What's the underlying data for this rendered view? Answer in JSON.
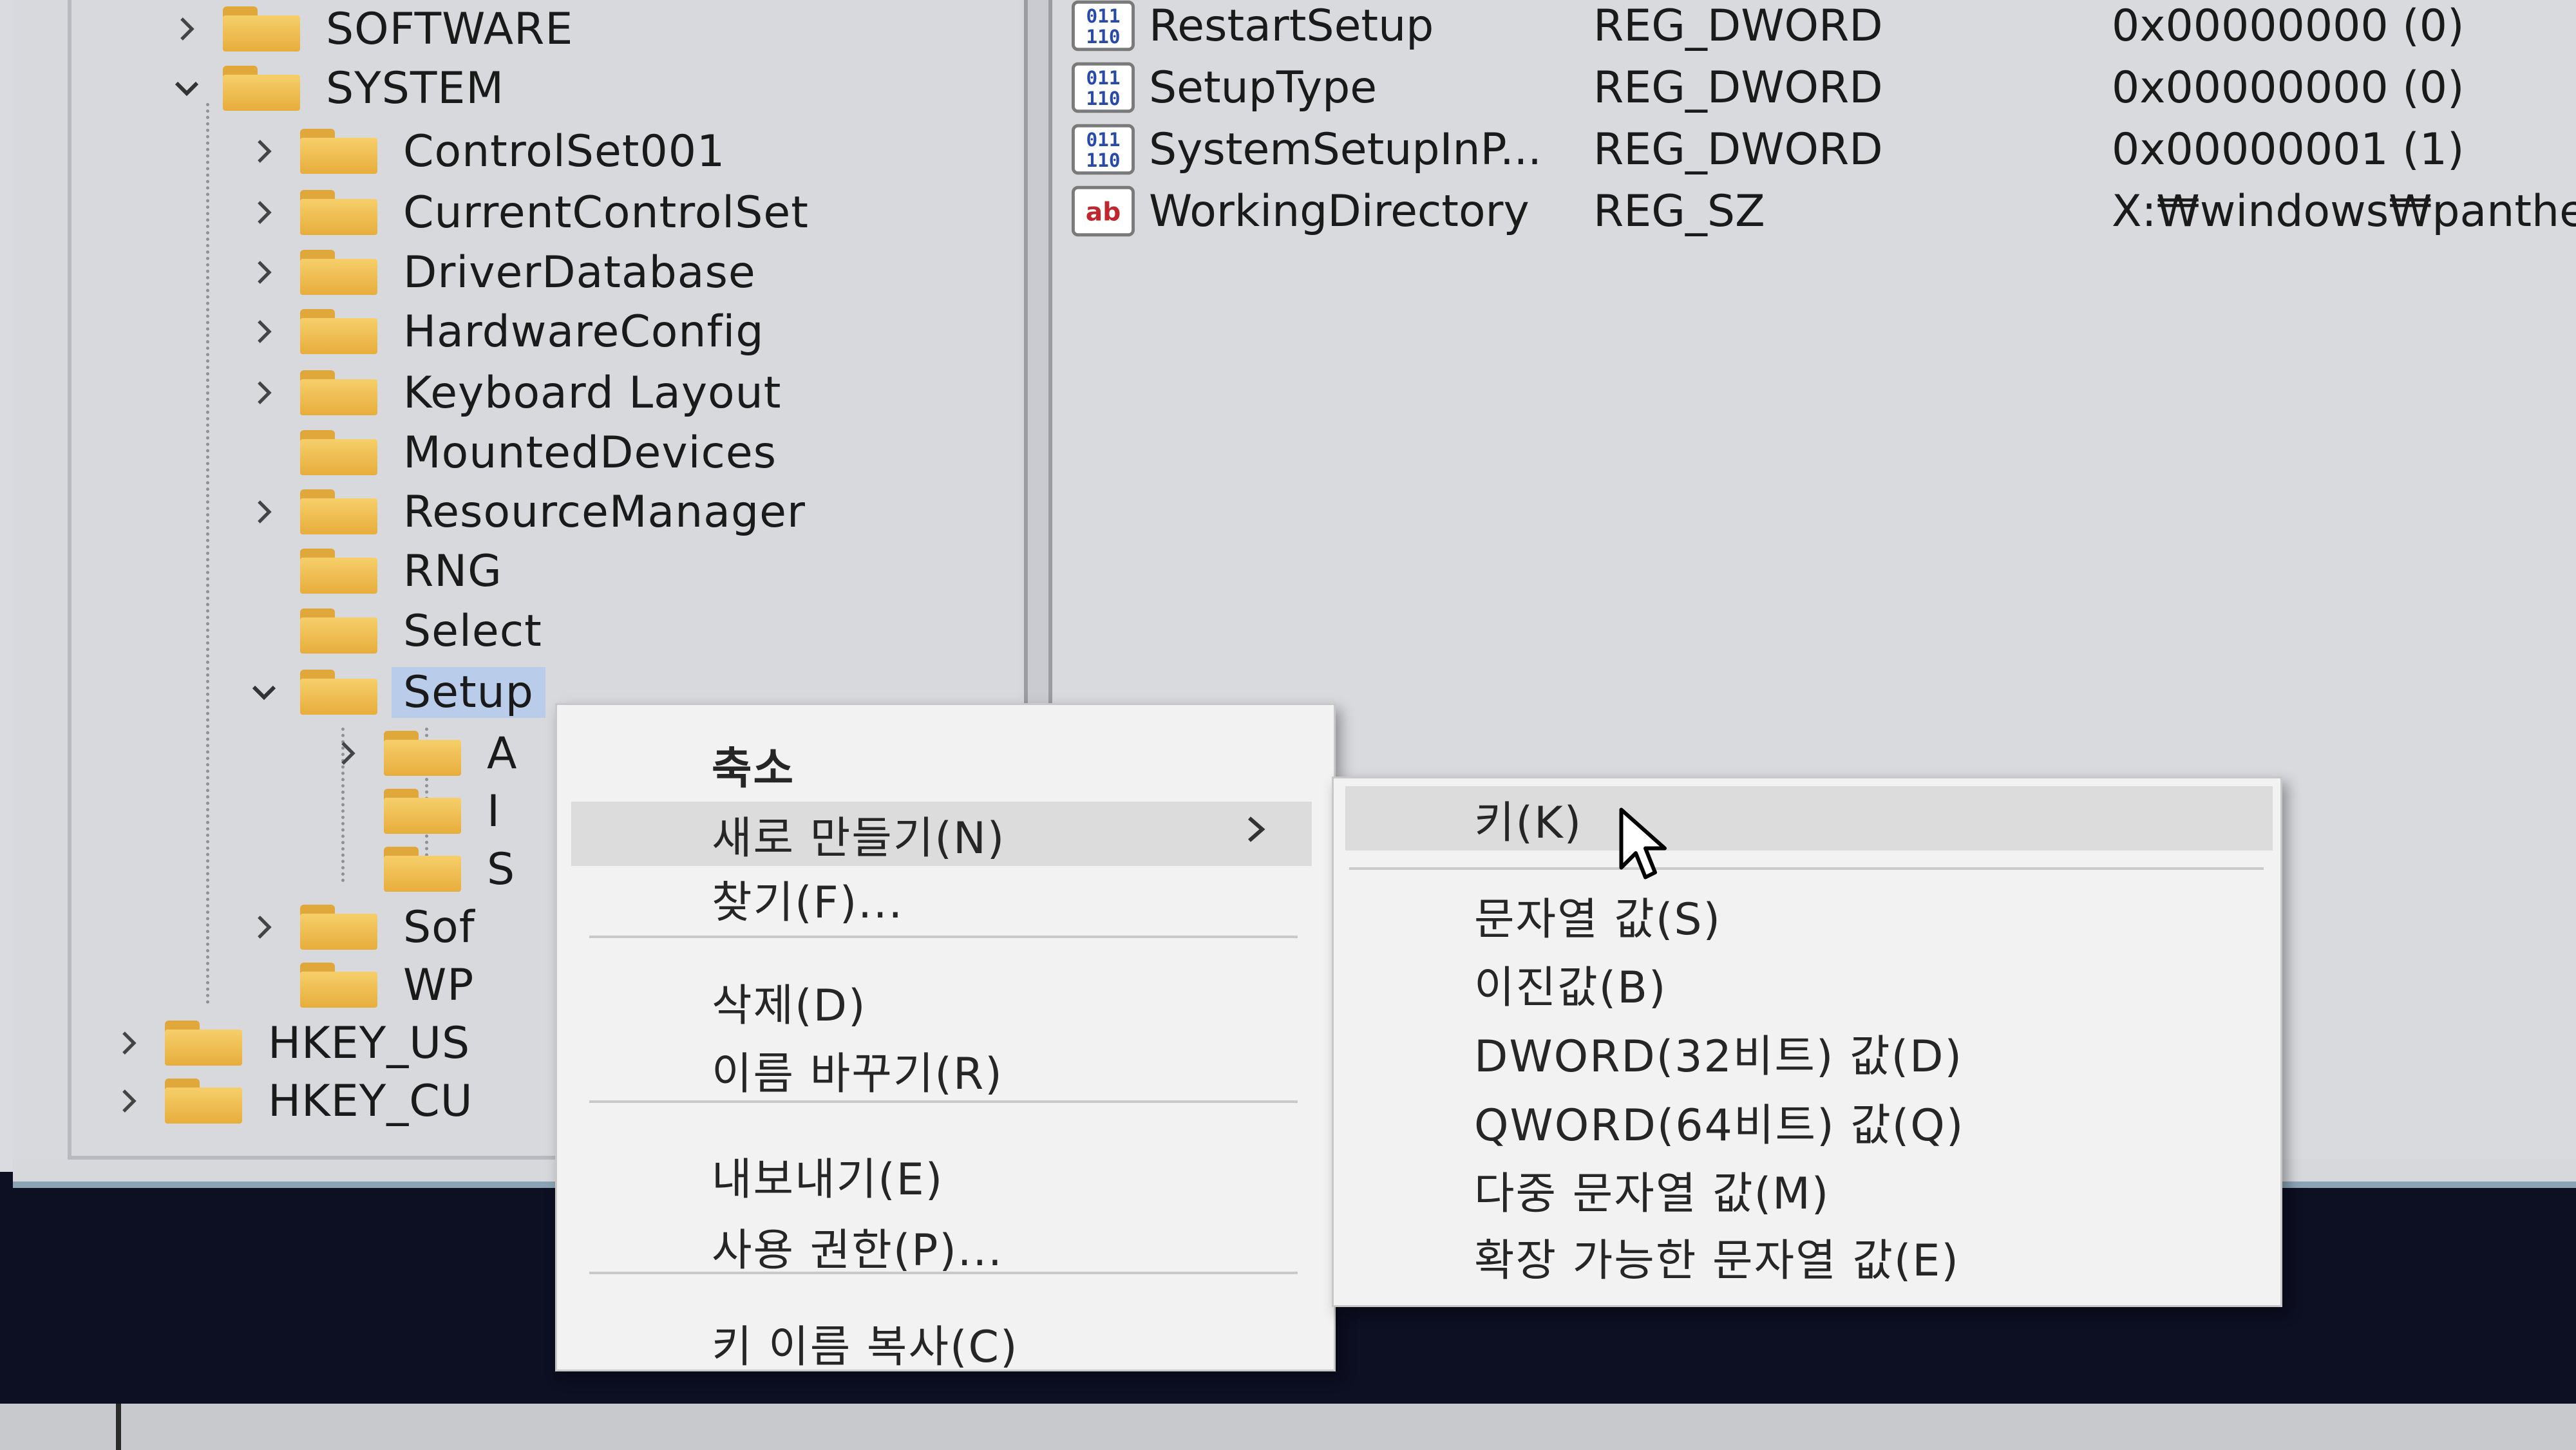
{
  "tree": {
    "items": [
      {
        "label": "SOFTWARE",
        "expander": "chevron-right"
      },
      {
        "label": "SYSTEM",
        "expander": "chevron-down"
      },
      {
        "label": "ControlSet001",
        "expander": "chevron-right"
      },
      {
        "label": "CurrentControlSet",
        "expander": "chevron-right"
      },
      {
        "label": "DriverDatabase",
        "expander": "chevron-right"
      },
      {
        "label": "HardwareConfig",
        "expander": "chevron-right"
      },
      {
        "label": "Keyboard Layout",
        "expander": "chevron-right"
      },
      {
        "label": "MountedDevices",
        "expander": "none"
      },
      {
        "label": "ResourceManager",
        "expander": "chevron-right"
      },
      {
        "label": "RNG",
        "expander": "none"
      },
      {
        "label": "Select",
        "expander": "none"
      },
      {
        "label": "Setup",
        "expander": "chevron-down",
        "selected": true
      },
      {
        "label": "A",
        "expander": "chevron-right"
      },
      {
        "label": "I",
        "expander": "none"
      },
      {
        "label": "S",
        "expander": "none"
      },
      {
        "label": "Sof",
        "expander": "chevron-right"
      },
      {
        "label": "WP",
        "expander": "none"
      },
      {
        "label": "HKEY_US",
        "expander": "chevron-right"
      },
      {
        "label": "HKEY_CU",
        "expander": "chevron-right"
      }
    ]
  },
  "values": {
    "rows": [
      {
        "icon": "binary-value-icon",
        "name": "RestartSetup",
        "type": "REG_DWORD",
        "data": "0x00000000 (0)"
      },
      {
        "icon": "binary-value-icon",
        "name": "SetupType",
        "type": "REG_DWORD",
        "data": "0x00000000 (0)"
      },
      {
        "icon": "binary-value-icon",
        "name": "SystemSetupInP...",
        "type": "REG_DWORD",
        "data": "0x00000001 (1)"
      },
      {
        "icon": "string-value-icon",
        "name": "WorkingDirectory",
        "type": "REG_SZ",
        "data": "X:₩windows₩panthe"
      }
    ],
    "string_icon_text": "ab",
    "binary_icon_text": "011\n110"
  },
  "context_menu": {
    "items": [
      {
        "label": "축소",
        "bold": true
      },
      {
        "label": "새로 만들기(N)",
        "has_submenu": true,
        "hover": true
      },
      {
        "label": "찾기(F)..."
      },
      {
        "label": "삭제(D)"
      },
      {
        "label": "이름 바꾸기(R)"
      },
      {
        "label": "내보내기(E)"
      },
      {
        "label": "사용 권한(P)..."
      },
      {
        "label": "키 이름 복사(C)"
      }
    ]
  },
  "submenu": {
    "items": [
      {
        "label": "키(K)",
        "hover": true
      },
      {
        "label": "문자열 값(S)"
      },
      {
        "label": "이진값(B)"
      },
      {
        "label": "DWORD(32비트) 값(D)"
      },
      {
        "label": "QWORD(64비트) 값(Q)"
      },
      {
        "label": "다중 문자열 값(M)"
      },
      {
        "label": "확장 가능한 문자열 값(E)"
      }
    ]
  },
  "colors": {
    "folder": "#e7ad3c",
    "selection": "#b9ccea",
    "menu_bg": "#f2f2f2",
    "desktop": "#0d0f22"
  }
}
